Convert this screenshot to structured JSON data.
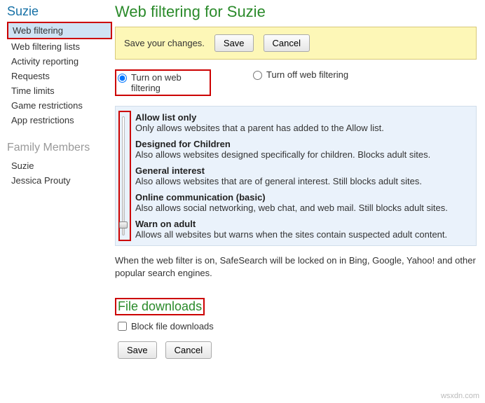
{
  "sidebar": {
    "title": "Suzie",
    "items": [
      {
        "label": "Web filtering",
        "selected": true
      },
      {
        "label": "Web filtering lists"
      },
      {
        "label": "Activity reporting"
      },
      {
        "label": "Requests"
      },
      {
        "label": "Time limits"
      },
      {
        "label": "Game restrictions"
      },
      {
        "label": "App restrictions"
      }
    ],
    "members_title": "Family Members",
    "members": [
      {
        "label": "Suzie"
      },
      {
        "label": "Jessica Prouty"
      }
    ]
  },
  "page_title": "Web filtering for Suzie",
  "banner": {
    "text": "Save your changes.",
    "save": "Save",
    "cancel": "Cancel"
  },
  "radios": {
    "on": "Turn on web filtering",
    "off": "Turn off web filtering"
  },
  "levels": [
    {
      "title": "Allow list only",
      "desc": "Only allows websites that a parent has added to the Allow list."
    },
    {
      "title": "Designed for Children",
      "desc": "Also allows websites designed specifically for children. Blocks adult sites."
    },
    {
      "title": "General interest",
      "desc": "Also allows websites that are of general interest. Still blocks adult sites."
    },
    {
      "title": "Online communication (basic)",
      "desc": "Also allows social networking, web chat, and web mail. Still blocks adult sites."
    },
    {
      "title": "Warn on adult",
      "desc": "Allows all websites but warns when the sites contain suspected adult content."
    }
  ],
  "safesearch_note": "When the web filter is on, SafeSearch will be locked on in Bing, Google, Yahoo! and other popular search engines.",
  "downloads": {
    "header": "File downloads",
    "checkbox": "Block file downloads"
  },
  "bottom": {
    "save": "Save",
    "cancel": "Cancel"
  },
  "watermark": "wsxdn.com"
}
